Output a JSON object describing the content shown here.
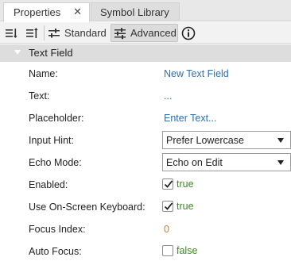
{
  "tabs": [
    {
      "label": "Properties",
      "active": true,
      "close": "✕"
    },
    {
      "label": "Symbol Library",
      "active": false
    }
  ],
  "toolbar": {
    "standard_label": "Standard",
    "advanced_label": "Advanced",
    "icons": [
      "sort-ascending-icon",
      "sort-descending-icon",
      "sliders-icon",
      "sliders-icon",
      "info-icon"
    ]
  },
  "section": {
    "title": "Text Field"
  },
  "properties": [
    {
      "label": "Name:",
      "value": "New Text Field",
      "kind": "link"
    },
    {
      "label": "Text:",
      "value": "...",
      "kind": "link"
    },
    {
      "label": "Placeholder:",
      "value": "Enter Text...",
      "kind": "link"
    },
    {
      "label": "Input Hint:",
      "value": "Prefer Lowercase",
      "kind": "select"
    },
    {
      "label": "Echo Mode:",
      "value": "Echo on Edit",
      "kind": "select"
    },
    {
      "label": "Enabled:",
      "value": "true",
      "kind": "checkbox",
      "checked": true
    },
    {
      "label": "Use On-Screen Keyboard:",
      "value": "true",
      "kind": "checkbox",
      "checked": true
    },
    {
      "label": "Focus Index:",
      "value": "0",
      "kind": "number"
    },
    {
      "label": "Auto Focus:",
      "value": "false",
      "kind": "checkbox",
      "checked": false
    }
  ],
  "colors": {
    "link": "#2a6fb3",
    "true_value": "#3b8a1f",
    "number_value": "#d77a2a",
    "section_bg": "#dddddd"
  }
}
